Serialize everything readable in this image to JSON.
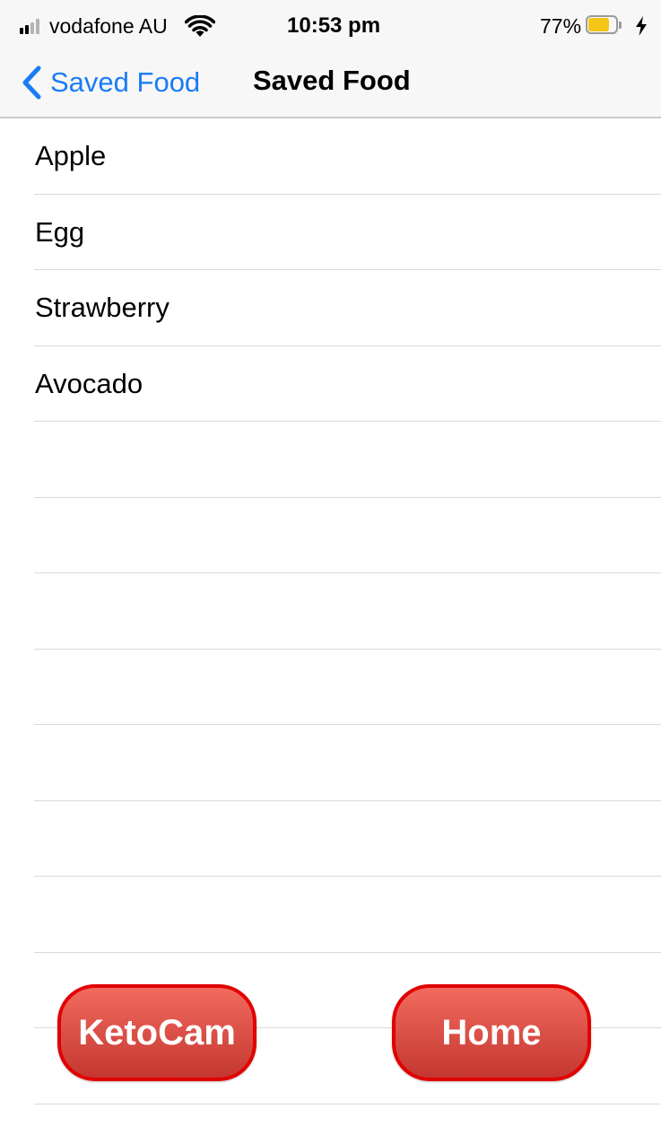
{
  "colors": {
    "ios_blue": "#1a7cf5",
    "nav_background": "#f7f7f7",
    "separator": "#d9d9d9",
    "battery_fill": "#f5c518",
    "button_gradient_top": "#f26a5e",
    "button_gradient_bottom": "#c43730",
    "button_border": "#e20000",
    "button_text": "#ffffff"
  },
  "status_bar": {
    "signal_icon": "cellular-signal-icon",
    "carrier": "vodafone AU",
    "wifi_icon": "wifi-icon",
    "time": "10:53 pm",
    "battery_percent": "77%",
    "battery_level": 0.77,
    "battery_icon": "battery-icon",
    "charging_icon": "charging-bolt-icon"
  },
  "nav": {
    "back_icon": "chevron-left-icon",
    "back_label": "Saved Food",
    "title": "Saved Food"
  },
  "foods": [
    "Apple",
    "Egg",
    "Strawberry",
    "Avocado"
  ],
  "empty_rows": 9,
  "buttons": {
    "ketocam_label": "KetoCam",
    "home_label": "Home"
  }
}
